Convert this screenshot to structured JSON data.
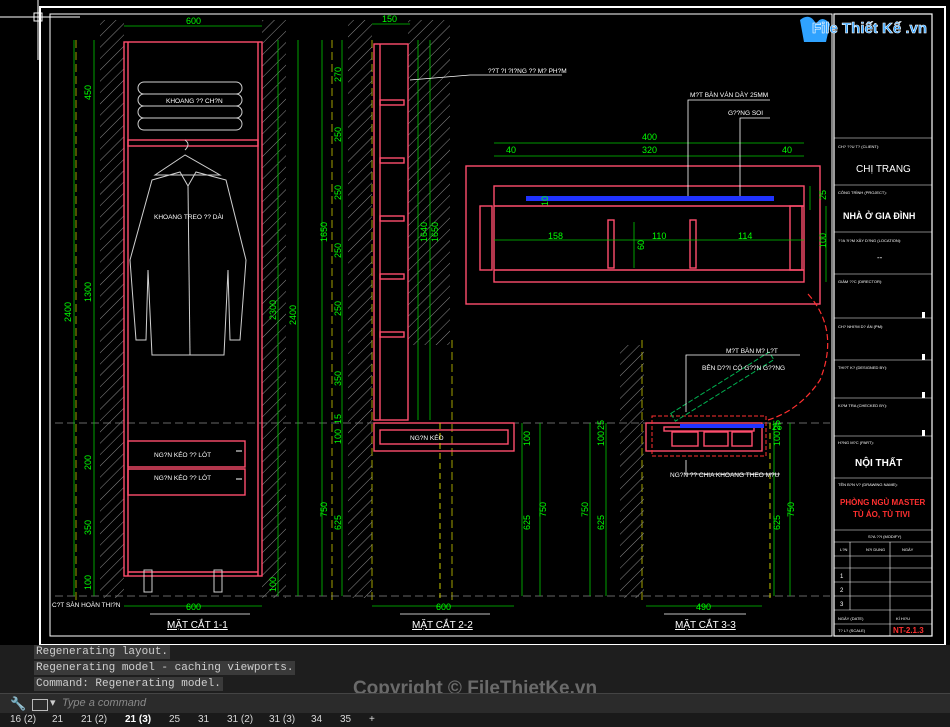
{
  "colors": {
    "frame": "#ffffff",
    "dim": "#00ff00",
    "furniture": "#ff4d6d",
    "hatch": "#9a9a9a",
    "blue": "#3b4dff",
    "leader": "#ffffff",
    "accent": "#ff3030",
    "yellow": "#ffff00"
  },
  "section1": {
    "label": "MẶT CẮT 1-1",
    "dims": {
      "top": "600",
      "bottom": "600",
      "total_left": "2400",
      "upper": "450",
      "mid": "1300",
      "lower": "200",
      "lower2": "350",
      "base": "100",
      "right_inner": "2300",
      "right_outer": "2400",
      "right_base": "100"
    },
    "labels": {
      "shelf": "KHOANG ?? CH?N",
      "hanging": "KHOANG TREO ?? DÀI",
      "drawer1": "NG?N KÉO ?? LÓT",
      "drawer2": "NG?N KÉO ?? LÓT"
    },
    "floor_note": "C?T SÀN HOÀN THI?N"
  },
  "section2": {
    "label": "MẶT CẮT 2-2",
    "dims": {
      "top": "150",
      "bottom": "600",
      "d1": "270",
      "d2": "250",
      "d3": "250",
      "d4": "250",
      "d5": "250",
      "d6": "350",
      "d7": "15",
      "d8": "100",
      "d9": "750",
      "d10": "625",
      "left_total": "1650",
      "right1": "1640",
      "right2": "1650",
      "right_a": "100",
      "right_b": "750",
      "right_c": "625"
    },
    "labels": {
      "top_note": "??T ?I ?I?NG ?? M? PH?M",
      "drawer": "NG?N KÉO"
    }
  },
  "detail": {
    "dims": {
      "w400": "400",
      "w320": "320",
      "l40": "40",
      "r40": "40",
      "d10": "10",
      "c158": "158",
      "c110": "110",
      "c114": "114",
      "h60": "60",
      "h25": "25",
      "h100": "100"
    },
    "labels": {
      "wood": "M?T BÀN VÁN DÀY 25MM",
      "mirror": "G??NG SOI"
    }
  },
  "section3": {
    "label": "MẶT CẮT 3-3",
    "dims": {
      "bottom": "490",
      "l100": "100",
      "l25": "25",
      "l750": "750",
      "l625": "625",
      "r100": "100",
      "r25": "25",
      "r750": "750",
      "r625": "625",
      "top25": "25"
    },
    "labels": {
      "lift": "M?T BÀN M? L?T",
      "mirror": "BÊN D??I CÓ G??N G??NG",
      "drawer": "NG?N ?? CHIA KHOANG THEO M?U"
    }
  },
  "title_block": {
    "logo_text": "File Thiết Kế .vn",
    "owner_label": "CH? ??U T? (CLIENT):",
    "owner": "CHỊ TRANG",
    "project_label": "CÔNG TRÌNH (PROJECT):",
    "project": "NHÀ Ở GIA ĐÌNH",
    "address_label": "??A ?I?M XÂY D?NG (LOCATION):",
    "address": "--",
    "row1": "GIÁM ??C (DIRECTOR):",
    "row2": "CH? NHI?M D? ÁN (PM):",
    "row3": "THI?T K? (DESIGNED BY):",
    "row4": "KI?M TRA (CHECKED BY):",
    "category_label": "H?NG M?C (PART):",
    "category": "NỘI THẤT",
    "drawing_label": "TÊN B?N V? (DRAWING NAME):",
    "drawing1": "PHÒNG NGỦ MASTER",
    "drawing2": "TỦ ÁO, TỦ TIVI",
    "rev_label": "S?A ??I (MODIFY)",
    "rev_cols": [
      "L?N",
      "N?I DUNG",
      "NGÀY"
    ],
    "rev_rows": [
      "1",
      "2",
      "3"
    ],
    "date_label": "NGÀY (DATE)",
    "scale_label": "T? L? (SCALE)",
    "sheet_label": "KÍ HI?U",
    "sheet": "NT-2.1.3"
  },
  "command_history": [
    "Regenerating layout.",
    "Regenerating model - caching viewports.",
    "Command: Regenerating model."
  ],
  "command_placeholder": "Type a command",
  "tabs": [
    "16 (2)",
    "21",
    "21 (2)",
    "21 (3)",
    "25",
    "31",
    "31 (2)",
    "31 (3)",
    "34",
    "35",
    "+"
  ],
  "active_tab": "21 (3)",
  "watermark": "Copyright © FileThietKe.vn"
}
